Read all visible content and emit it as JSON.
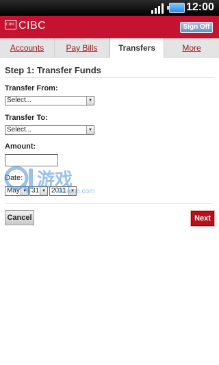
{
  "status_bar": {
    "time": "12:00",
    "signal_icon": "signal-icon",
    "battery_icon": "battery-icon"
  },
  "brand": {
    "logo_mark": "CIBC",
    "name": "CIBC",
    "sign_off_label": "Sign Off",
    "color": "#c41230"
  },
  "tabs": [
    {
      "label": "Accounts",
      "active": false
    },
    {
      "label": "Pay Bills",
      "active": false
    },
    {
      "label": "Transfers",
      "active": true
    },
    {
      "label": "More",
      "active": false
    }
  ],
  "form": {
    "step_title": "Step 1: Transfer Funds",
    "transfer_from": {
      "label": "Transfer From:",
      "value": "Select..."
    },
    "transfer_to": {
      "label": "Transfer To:",
      "value": "Select..."
    },
    "amount": {
      "label": "Amount:",
      "value": ""
    },
    "date": {
      "label": "Date:",
      "month": "May",
      "day": "31",
      "year": "2011"
    }
  },
  "buttons": {
    "cancel": "Cancel",
    "next": "Next"
  },
  "watermark": {
    "text": "游戏",
    "subtext": "9Game.com"
  }
}
